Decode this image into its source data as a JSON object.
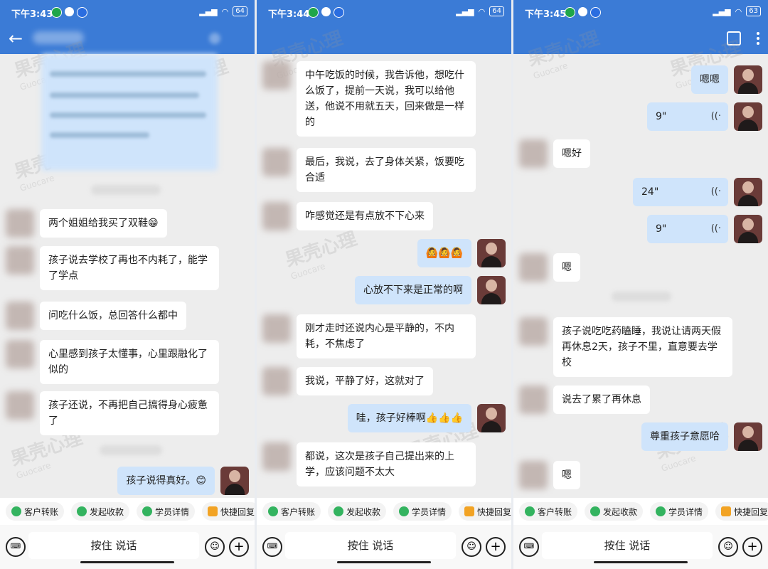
{
  "panels": [
    {
      "time": "下午3:43",
      "battery": "64"
    },
    {
      "time": "下午3:44",
      "battery": "64"
    },
    {
      "time": "下午3:45",
      "battery": "63"
    }
  ],
  "watermark": {
    "cn": "果壳心理",
    "en": "Guocare"
  },
  "quick_actions": [
    "客户转账",
    "发起收款",
    "学员详情",
    "快捷回复"
  ],
  "input": {
    "talk_label": "按住 说话"
  },
  "messages": {
    "p1": [
      "两个姐姐给我买了双鞋😁",
      "孩子说去学校了再也不内耗了，能学了学点",
      "问吃什么饭，总回答什么都中",
      "心里感到孩子太懂事，心里跟融化了似的",
      "孩子还说，不再把自己搞得身心疲惫了",
      "孩子说得真好。😊"
    ],
    "p2": [
      "中午吃饭的时候，我告诉他，想吃什么饭了，提前一天说，我可以给他送，他说不用就五天，回来做是一样的",
      "最后，我说，去了身体关紧，饭要吃合适",
      "咋感觉还是有点放不下心来",
      "🙆🙆🙆",
      "心放不下来是正常的啊",
      "刚才走时还说内心是平静的，不内耗，不焦虑了",
      "我说，平静了好，这就对了",
      "哇，孩子好棒啊👍👍👍",
      "都说，这次是孩子自己提出来的上学，应该问题不太大"
    ],
    "p3": [
      "嗯嗯",
      "9\"",
      "嗯好",
      "24\"",
      "9\"",
      "嗯",
      "孩子说吃吃药瞌睡，我说让请两天假再休息2天，孩子不里，直意要去学校",
      "说去了累了再休息",
      "尊重孩子意愿哈",
      "嗯"
    ]
  }
}
